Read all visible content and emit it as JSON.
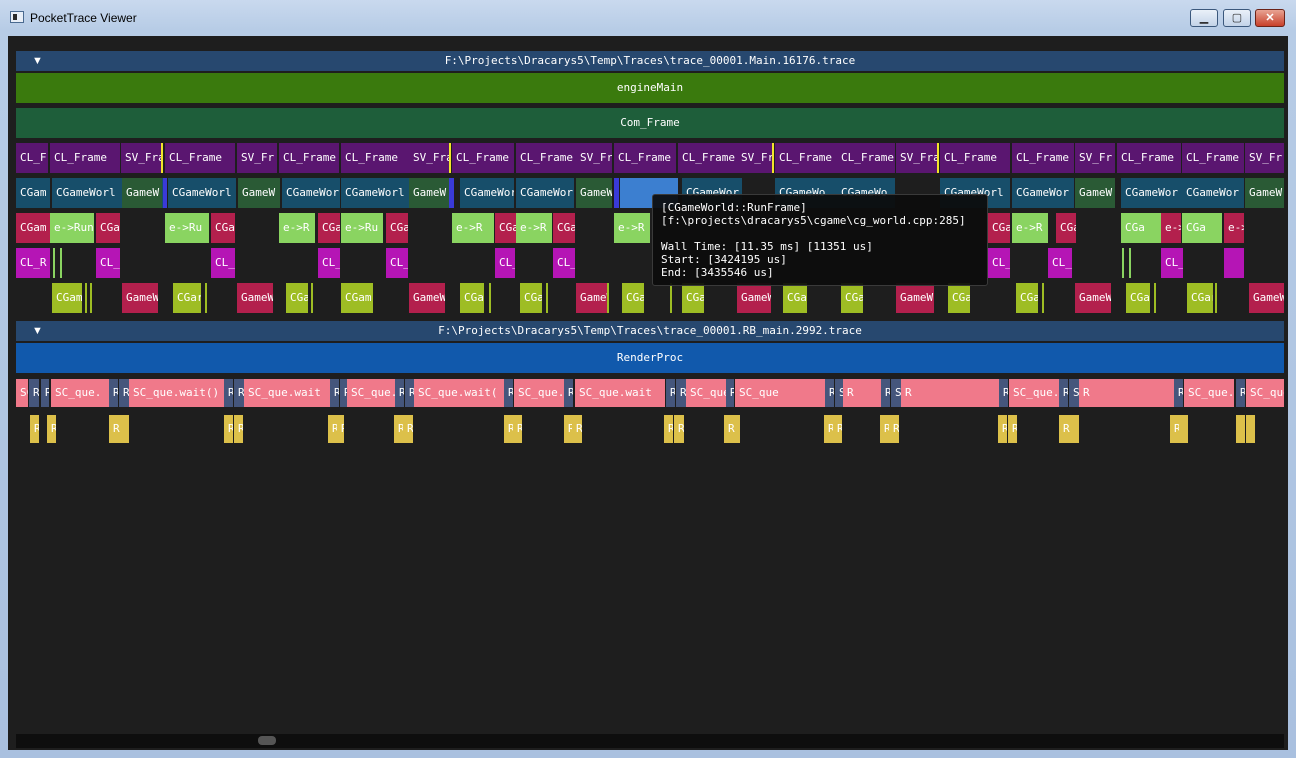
{
  "window": {
    "title": "PocketTrace Viewer",
    "buttons": {
      "minimize": "▁",
      "maximize": "▢",
      "close": "✕"
    }
  },
  "colors": {
    "main_header": "#27486f",
    "engineMain": "#3a7a0d",
    "com_frame": "#1e5e3a",
    "frame_purple": "#5a1670",
    "gameworld_teal": "#174e6a",
    "gameworld_dark_green": "#2a5a35",
    "runframe_green": "#8ad461",
    "cgame_red": "#b3204d",
    "cl_magenta": "#b515b5",
    "gen_lime": "#9ebd24",
    "renderproc": "#1159ac",
    "sc_pink": "#f0798a",
    "r_slate": "#45567c",
    "r_yellow": "#dcc04a"
  },
  "threads": [
    {
      "header": "F:\\Projects\\Dracarys5\\Temp\\Traces\\trace_00001.Main.16176.trace",
      "root": "engineMain",
      "lanes": {
        "com_frame": "Com_Frame",
        "frames": [
          "CL_F",
          "CL_Frame",
          "SV_Fra",
          "CL_Frame",
          "SV_Fr",
          "CL_Frame",
          "CL_Frame",
          "SV_Fra",
          "CL_Frame",
          "CL_Frame",
          "SV_Fr",
          "CL_Frame",
          "CL_Frame",
          "SV_Fr",
          "CL_Frame",
          "CL_Frame",
          "SV_Fra",
          "CL_Frame",
          "CL_Frame",
          "SV_Fr",
          "CL_Frame",
          "CL_Frame",
          "SV_Fr"
        ],
        "world": [
          "CGam",
          "CGameWorl",
          "GameW",
          "CGameWorl",
          "GameW",
          "CGameWor",
          "CGameWorl",
          "GameW",
          "CGameWor",
          "CGameWor",
          "GameW",
          "CGameWor",
          "CGameWor",
          "CGameWo",
          "CGameWo",
          "CGameWorl",
          "CGameWor",
          "GameW",
          "CGameWor",
          "CGameWor",
          "GameW"
        ],
        "run": [
          "CGam",
          "e->Run",
          "CGar",
          "e->Ru",
          "CGa",
          "e->R",
          "CGa",
          "e->Ru",
          "CGa",
          "e->R",
          "CGa",
          "e->R",
          "CGa",
          "e->R",
          "CGa",
          "e->R",
          "CGam",
          "CGa",
          "e->Ru",
          "CGa",
          "e->Ru",
          "CGa"
        ],
        "cl": [
          "CL_R",
          "CL_",
          "CL_",
          "CL_",
          "CL_",
          "CL_",
          "CL_",
          "CL_",
          "CL_",
          "CL_"
        ],
        "gen": [
          "CGam",
          "GameW",
          "CGar",
          "GameW",
          "CGa",
          "CGam",
          "GameW",
          "CGa",
          "CGa",
          "GameW",
          "CGa",
          "CGa",
          "GameW",
          "CGa",
          "CGa",
          "GameW",
          "CGa",
          "CGa",
          "GameW",
          "CGa",
          "CGar",
          "GameW"
        ]
      }
    },
    {
      "header": "F:\\Projects\\Dracarys5\\Temp\\Traces\\trace_00001.RB_main.2992.trace",
      "root": "RenderProc",
      "lanes": {
        "sc": [
          "SC",
          "R",
          "R",
          "SC_que.",
          "R",
          "R",
          "SC_que.wait()",
          "R",
          "R",
          "SC_que.wait",
          "R",
          "R",
          "SC_que.",
          "R",
          "R",
          "SC_que.wait(",
          "R",
          "SC_que.",
          "R",
          "SC_que.wait",
          "R",
          "R",
          "SC_que.wait",
          "R",
          "SC_que",
          "R",
          "SC_que.wait",
          "R",
          "R",
          "SC_qu",
          "R",
          "R",
          "SC_que.wait()",
          "R",
          "SC_que",
          "R",
          "R",
          "SC_que.wait(",
          "R",
          "SC_que",
          "R",
          "SC_qu"
        ],
        "r": [
          "R",
          "R",
          "R",
          "R",
          "R",
          "R",
          "R",
          "R",
          "R",
          "R",
          "R",
          "R",
          "R",
          "R",
          "R",
          "R",
          "R",
          "R",
          "R",
          "R",
          "R",
          "R",
          "R",
          "R"
        ]
      }
    }
  ],
  "tooltip": {
    "name": "[CGameWorld::RunFrame]",
    "location": "[f:\\projects\\dracarys5\\cgame\\cg_world.cpp:285]",
    "wall_time": "Wall Time: [11.35 ms] [11351 us]",
    "start": "Start: [3424195 us]",
    "end": "End: [3435546 us]"
  }
}
